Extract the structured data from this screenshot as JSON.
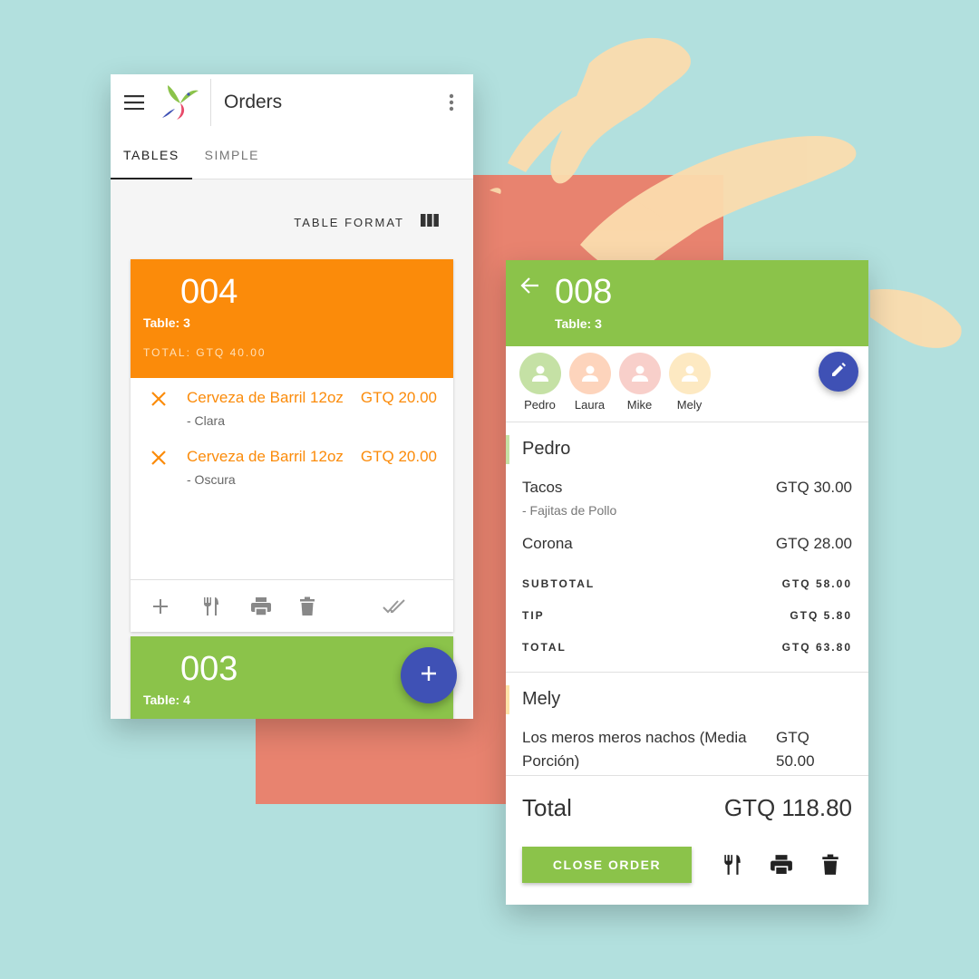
{
  "colors": {
    "background": "#b2e0de",
    "accent_square": "#e8836f",
    "brush": "#fbdcae",
    "orange": "#fb8b0a",
    "green": "#8bc34a",
    "fab_blue": "#3f51b5"
  },
  "left_screen": {
    "title": "Orders",
    "icons": {
      "menu": "menu-icon",
      "more": "more-vert-icon",
      "logo": "hummingbird-logo"
    },
    "tabs": [
      {
        "label": "TABLES",
        "active": true
      },
      {
        "label": "SIMPLE",
        "active": false
      }
    ],
    "format_label": "TABLE FORMAT",
    "orders": [
      {
        "number": "004",
        "table": "Table: 3",
        "total": "TOTAL: GTQ 40.00",
        "color": "#fb8b0a",
        "items": [
          {
            "name": "Cerveza de Barril 12oz",
            "price": "GTQ 20.00",
            "note": "- Clara"
          },
          {
            "name": "Cerveza de Barril 12oz",
            "price": "GTQ 20.00",
            "note": "- Oscura"
          }
        ]
      },
      {
        "number": "003",
        "table": "Table: 4",
        "color": "#8bc34a"
      }
    ],
    "actions": [
      "add-icon",
      "restaurant-icon",
      "print-icon",
      "delete-icon",
      "done-all-icon"
    ]
  },
  "right_screen": {
    "number": "008",
    "table": "Table: 3",
    "people": [
      {
        "name": "Pedro",
        "color": "#c5e1a5"
      },
      {
        "name": "Laura",
        "color": "#fdd4bc"
      },
      {
        "name": "Mike",
        "color": "#f8cfca"
      },
      {
        "name": "Mely",
        "color": "#fde9c2"
      }
    ],
    "sections": [
      {
        "person": "Pedro",
        "bar_color": "#c5e1a5",
        "items": [
          {
            "name": "Tacos",
            "price": "GTQ 30.00",
            "note": "- Fajitas de Pollo"
          },
          {
            "name": "Corona",
            "price": "GTQ 28.00"
          }
        ],
        "summary": [
          {
            "label": "SUBTOTAL",
            "value": "GTQ 58.00"
          },
          {
            "label": "TIP",
            "value": "GTQ 5.80"
          },
          {
            "label": "TOTAL",
            "value": "GTQ 63.80"
          }
        ]
      },
      {
        "person": "Mely",
        "bar_color": "#fde2a8",
        "items": [
          {
            "name": "Los meros meros nachos (Media Porción)",
            "price": "GTQ 50.00"
          }
        ]
      }
    ],
    "total_label": "Total",
    "total_value": "GTQ 118.80",
    "close_label": "CLOSE ORDER"
  }
}
